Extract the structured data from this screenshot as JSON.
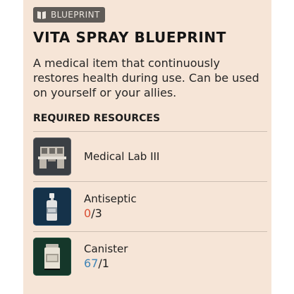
{
  "tag": {
    "icon": "blueprint-icon",
    "label": "BLUEPRINT"
  },
  "title": "VITA SPRAY BLUEPRINT",
  "description": "A medical item that continuously restores health during use. Can be used on yourself or your allies.",
  "resources_heading": "REQUIRED RESOURCES",
  "resources": [
    {
      "icon": "medical-lab-icon",
      "name": "Medical Lab III"
    },
    {
      "icon": "antiseptic-icon",
      "name": "Antiseptic",
      "have": "0",
      "sep": "/",
      "need": "3",
      "have_color": "#d94e33"
    },
    {
      "icon": "canister-icon",
      "name": "Canister",
      "have": "67",
      "sep": "/",
      "need": "1",
      "have_color": "#3f84b6"
    }
  ],
  "colors": {
    "panel": "#f6e5d7",
    "tag_bg": "#5f5b57",
    "insufficient": "#d94e33",
    "sufficient": "#3f84b6"
  }
}
